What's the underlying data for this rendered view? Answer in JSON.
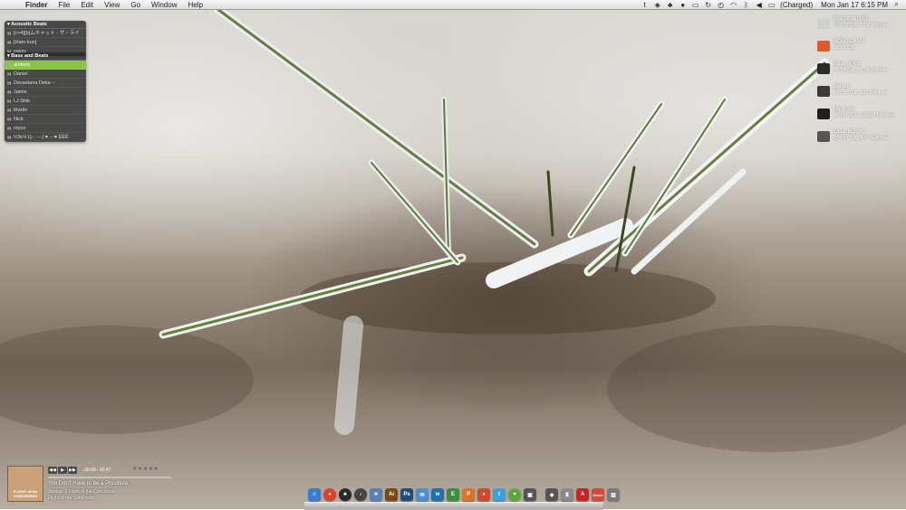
{
  "menubar": {
    "apple_glyph": "",
    "items": [
      "Finder",
      "File",
      "Edit",
      "View",
      "Go",
      "Window",
      "Help"
    ],
    "status_icons": [
      "twitter-icon",
      "dropbox-icon",
      "growl-icon",
      "evernote-icon",
      "mirror-icon",
      "sync-icon",
      "time-machine-icon",
      "wifi-icon",
      "bluetooth-icon",
      "volume-icon",
      "battery-icon"
    ],
    "battery_label": "(Charged)",
    "clock": "Mon Jan 17  6:15 PM",
    "spotlight_glyph": "⌕"
  },
  "playlists": [
    {
      "title": "Acoustic Beats",
      "items": [
        "[c=4][b]ムキャット - ザ・ライ",
        "[Hato-kun]",
        "sassy"
      ],
      "active": -1
    },
    {
      "title": "Bass and Beats",
      "items": [
        "andrew",
        "Daniel",
        "Devastana Deka -- ",
        "Jamie",
        "LJ Shik",
        "Martin",
        "Nick",
        "royce",
        "ЧЭсЧ Ц·· ·-·.| ♥.·:·♥ ЁЁЁ"
      ],
      "active": 0
    }
  ],
  "drives": [
    {
      "name": "Macintosh HD",
      "info": "199.72 GB, 77.8 GB free",
      "icon": "apple-drive-icon",
      "color": "#cfcfcf"
    },
    {
      "name": "BOOTCAMP",
      "info": "39.96 GB",
      "icon": "windows-drive-icon",
      "color": "#e35a2a"
    },
    {
      "name": "Bass_iPod",
      "info": "74.52 GB, 66.95 GB free",
      "icon": "ipod-drive-icon",
      "color": "#2b2b2b"
    },
    {
      "name": "Maxtor",
      "info": "596.15 GB, 222 GB free",
      "icon": "external-drive-icon",
      "color": "#3a3a3a"
    },
    {
      "name": "My Book",
      "info": "999.86 GB, 129.83 GB free",
      "icon": "external-drive-icon",
      "color": "#1f1f1f"
    },
    {
      "name": "OLD_BOOK",
      "info": "234.97 GB, 47.7 GB free",
      "icon": "external-drive-icon",
      "color": "#555555"
    }
  ],
  "now_playing": {
    "art_label": "FLIGHT of the CONCHORDS",
    "controls": [
      "◀◀",
      "▶",
      "▶▶"
    ],
    "time": "00:00 - 02:47",
    "stars": "★★★★★",
    "progress": 0.0,
    "title": "You Don't Have to be a Prostitute",
    "line2": "Season 2 Flight of the Conchords",
    "line3": "Flight of the Conchords"
  },
  "dock": [
    {
      "name": "finder",
      "glyph": "☺",
      "color": "#3a7bd5"
    },
    {
      "name": "chrome",
      "glyph": "●",
      "color": "#d9412c",
      "round": true
    },
    {
      "name": "adium",
      "glyph": "♣",
      "color": "#2a2a2a",
      "round": true
    },
    {
      "name": "itunes",
      "glyph": "♪",
      "color": "#444444",
      "round": true
    },
    {
      "name": "preview",
      "glyph": "⌗",
      "color": "#5a7fb5"
    },
    {
      "name": "illustrator",
      "glyph": "Ai",
      "color": "#7a4a12"
    },
    {
      "name": "photoshop",
      "glyph": "Ps",
      "color": "#1d4f7c"
    },
    {
      "name": "mail",
      "glyph": "✉",
      "color": "#4a8fd1"
    },
    {
      "name": "textmate",
      "glyph": "w",
      "color": "#1f6fb2"
    },
    {
      "name": "evernote",
      "glyph": "E",
      "color": "#3a8f3a"
    },
    {
      "name": "pages",
      "glyph": "P",
      "color": "#e0702a"
    },
    {
      "name": "feed-reader",
      "glyph": "♦",
      "color": "#d04a2a"
    },
    {
      "name": "tweetie",
      "glyph": "t",
      "color": "#3aa0e0"
    },
    {
      "name": "growl",
      "glyph": "♥",
      "color": "#5aa83a",
      "round": true
    },
    {
      "name": "photo-booth",
      "glyph": "▣",
      "color": "#555555"
    },
    {
      "name": "sep",
      "glyph": "",
      "color": "transparent"
    },
    {
      "name": "virtualbox",
      "glyph": "◆",
      "color": "#555555"
    },
    {
      "name": "archive",
      "glyph": "♜",
      "color": "#8a8a8a"
    },
    {
      "name": "adobe",
      "glyph": "A",
      "color": "#cc2222"
    },
    {
      "name": "downloads",
      "glyph": "Down",
      "color": "#d24a3a"
    },
    {
      "name": "trash",
      "glyph": "▥",
      "color": "#7a7a7a"
    }
  ]
}
